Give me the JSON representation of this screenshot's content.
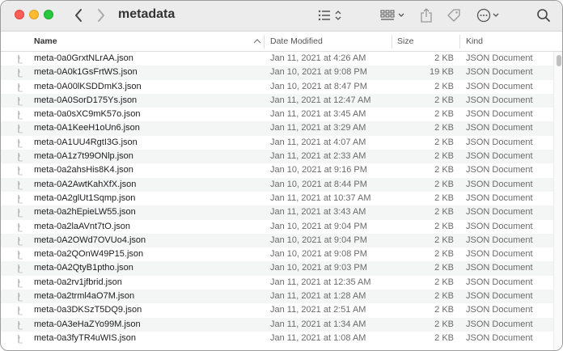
{
  "window": {
    "title": "metadata"
  },
  "toolbar": {
    "back_icon": "chevron-left-icon",
    "forward_icon": "chevron-right-icon",
    "view_icon": "list-view-icon",
    "group_icon": "grid-group-icon",
    "share_icon": "share-icon",
    "tag_icon": "tag-icon",
    "more_icon": "ellipsis-circle-icon",
    "search_icon": "search-icon"
  },
  "columns": {
    "name": "Name",
    "date": "Date Modified",
    "size": "Size",
    "kind": "Kind"
  },
  "files": [
    {
      "name": "meta-0a0GrxtNLrAA.json",
      "date": "Jan 11, 2021 at 4:26 AM",
      "size": "2 KB",
      "kind": "JSON Document"
    },
    {
      "name": "meta-0A0k1GsFrtWS.json",
      "date": "Jan 10, 2021 at 9:08 PM",
      "size": "19 KB",
      "kind": "JSON Document"
    },
    {
      "name": "meta-0A00lKSDDmK3.json",
      "date": "Jan 10, 2021 at 8:47 PM",
      "size": "2 KB",
      "kind": "JSON Document"
    },
    {
      "name": "meta-0A0SorD175Ys.json",
      "date": "Jan 11, 2021 at 12:47 AM",
      "size": "2 KB",
      "kind": "JSON Document"
    },
    {
      "name": "meta-0a0sXC9mK57o.json",
      "date": "Jan 11, 2021 at 3:45 AM",
      "size": "2 KB",
      "kind": "JSON Document"
    },
    {
      "name": "meta-0A1KeeH1oUn6.json",
      "date": "Jan 11, 2021 at 3:29 AM",
      "size": "2 KB",
      "kind": "JSON Document"
    },
    {
      "name": "meta-0A1UU4RgtI3G.json",
      "date": "Jan 11, 2021 at 4:07 AM",
      "size": "2 KB",
      "kind": "JSON Document"
    },
    {
      "name": "meta-0A1z7t99ONlp.json",
      "date": "Jan 11, 2021 at 2:33 AM",
      "size": "2 KB",
      "kind": "JSON Document"
    },
    {
      "name": "meta-0a2ahsHis8K4.json",
      "date": "Jan 10, 2021 at 9:16 PM",
      "size": "2 KB",
      "kind": "JSON Document"
    },
    {
      "name": "meta-0A2AwtKahXfX.json",
      "date": "Jan 10, 2021 at 8:44 PM",
      "size": "2 KB",
      "kind": "JSON Document"
    },
    {
      "name": "meta-0A2glUt1Sqmp.json",
      "date": "Jan 11, 2021 at 10:37 AM",
      "size": "2 KB",
      "kind": "JSON Document"
    },
    {
      "name": "meta-0a2hEpieLW55.json",
      "date": "Jan 11, 2021 at 3:43 AM",
      "size": "2 KB",
      "kind": "JSON Document"
    },
    {
      "name": "meta-0a2laAVnt7tO.json",
      "date": "Jan 10, 2021 at 9:04 PM",
      "size": "2 KB",
      "kind": "JSON Document"
    },
    {
      "name": "meta-0A2OWd7OVUo4.json",
      "date": "Jan 10, 2021 at 9:04 PM",
      "size": "2 KB",
      "kind": "JSON Document"
    },
    {
      "name": "meta-0a2QOnW49P15.json",
      "date": "Jan 10, 2021 at 9:08 PM",
      "size": "2 KB",
      "kind": "JSON Document"
    },
    {
      "name": "meta-0A2QtyB1ptho.json",
      "date": "Jan 10, 2021 at 9:03 PM",
      "size": "2 KB",
      "kind": "JSON Document"
    },
    {
      "name": "meta-0a2rv1jfbrid.json",
      "date": "Jan 11, 2021 at 12:35 AM",
      "size": "2 KB",
      "kind": "JSON Document"
    },
    {
      "name": "meta-0a2trml4aO7M.json",
      "date": "Jan 11, 2021 at 1:28 AM",
      "size": "2 KB",
      "kind": "JSON Document"
    },
    {
      "name": "meta-0a3DKSzT5DQ9.json",
      "date": "Jan 11, 2021 at 2:51 AM",
      "size": "2 KB",
      "kind": "JSON Document"
    },
    {
      "name": "meta-0A3eHaZYo99M.json",
      "date": "Jan 11, 2021 at 1:34 AM",
      "size": "2 KB",
      "kind": "JSON Document"
    },
    {
      "name": "meta-0a3fyTR4uWIS.json",
      "date": "Jan 11, 2021 at 1:08 AM",
      "size": "2 KB",
      "kind": "JSON Document"
    }
  ],
  "file_icon": "document-icon"
}
